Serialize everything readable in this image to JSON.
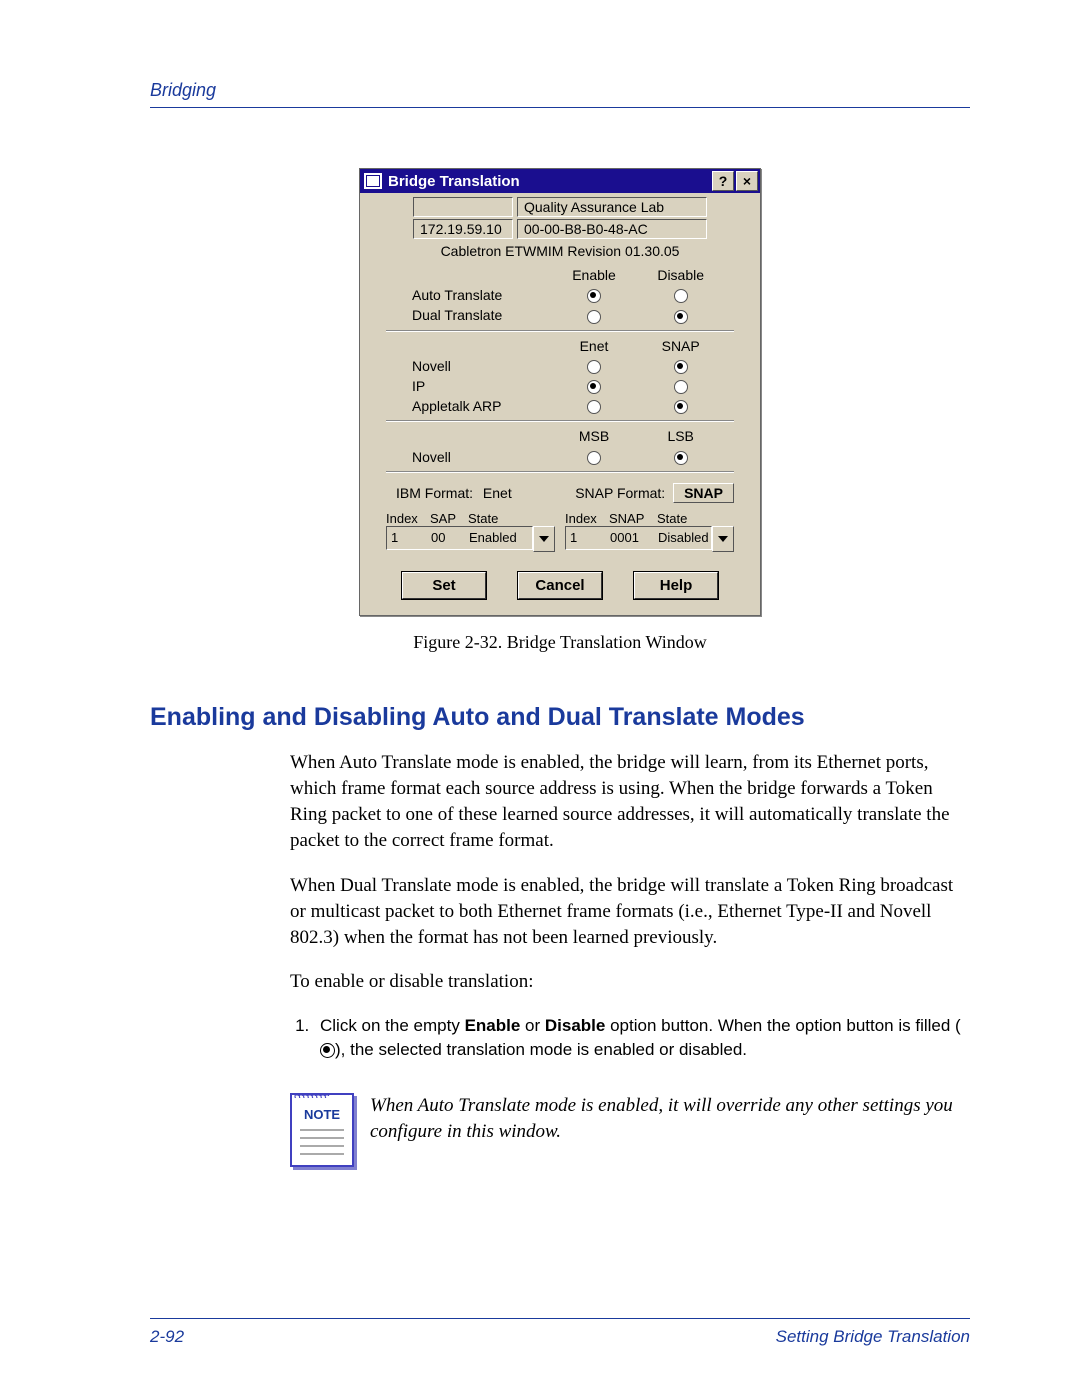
{
  "header": {
    "title": "Bridging"
  },
  "dialog": {
    "title": "Bridge Translation",
    "help_btn": "?",
    "close_btn": "×",
    "meta": {
      "ip": "172.19.59.10",
      "qa": "Quality Assurance Lab",
      "mac": "00-00-B8-B0-48-AC"
    },
    "revision": "Cabletron ETWMIM Revision 01.30.05",
    "group1": {
      "col1": "Enable",
      "col2": "Disable",
      "rows": [
        {
          "label": "Auto Translate",
          "sel": 0
        },
        {
          "label": "Dual Translate",
          "sel": 1
        }
      ]
    },
    "group2": {
      "col1": "Enet",
      "col2": "SNAP",
      "rows": [
        {
          "label": "Novell",
          "sel": 1
        },
        {
          "label": "IP",
          "sel": 0
        },
        {
          "label": "Appletalk ARP",
          "sel": 1
        }
      ]
    },
    "group3": {
      "col1": "MSB",
      "col2": "LSB",
      "rows": [
        {
          "label": "Novell",
          "sel": 1
        }
      ]
    },
    "formats": {
      "ibm_label": "IBM Format:",
      "ibm_value": "Enet",
      "snap_label": "SNAP Format:",
      "snap_value": "SNAP"
    },
    "list_left": {
      "h1": "Index",
      "h2": "SAP",
      "h3": "State",
      "v1": "1",
      "v2": "00",
      "v3": "Enabled"
    },
    "list_right": {
      "h1": "Index",
      "h2": "SNAP",
      "h3": "State",
      "v1": "1",
      "v2": "0001",
      "v3": "Disabled"
    },
    "buttons": {
      "set": "Set",
      "cancel": "Cancel",
      "help": "Help"
    }
  },
  "caption": "Figure 2-32. Bridge Translation Window",
  "section_heading": "Enabling and Disabling Auto and Dual Translate Modes",
  "paragraphs": {
    "p1": "When Auto Translate mode is enabled, the bridge will learn, from its Ethernet ports, which frame format each source address is using. When the bridge forwards a Token Ring packet to one of these learned source addresses, it will automatically translate the packet to the correct frame format.",
    "p2": "When Dual Translate mode is enabled, the bridge will translate a Token Ring broadcast or multicast packet to both Ethernet frame formats (i.e., Ethernet Type-II and Novell 802.3) when the format has not been learned previously.",
    "p3": "To enable or disable translation:"
  },
  "step": {
    "s1a": "Click on the empty ",
    "s1b": "Enable",
    "s1c": " or ",
    "s1d": "Disable",
    "s1e": " option button. When the option button is filled (",
    "s1f": "), the selected translation mode is enabled or disabled."
  },
  "note": {
    "label": "NOTE",
    "text": "When Auto Translate mode is enabled, it will override any other settings you configure in this window."
  },
  "footer": {
    "page": "2-92",
    "section": "Setting Bridge Translation"
  }
}
